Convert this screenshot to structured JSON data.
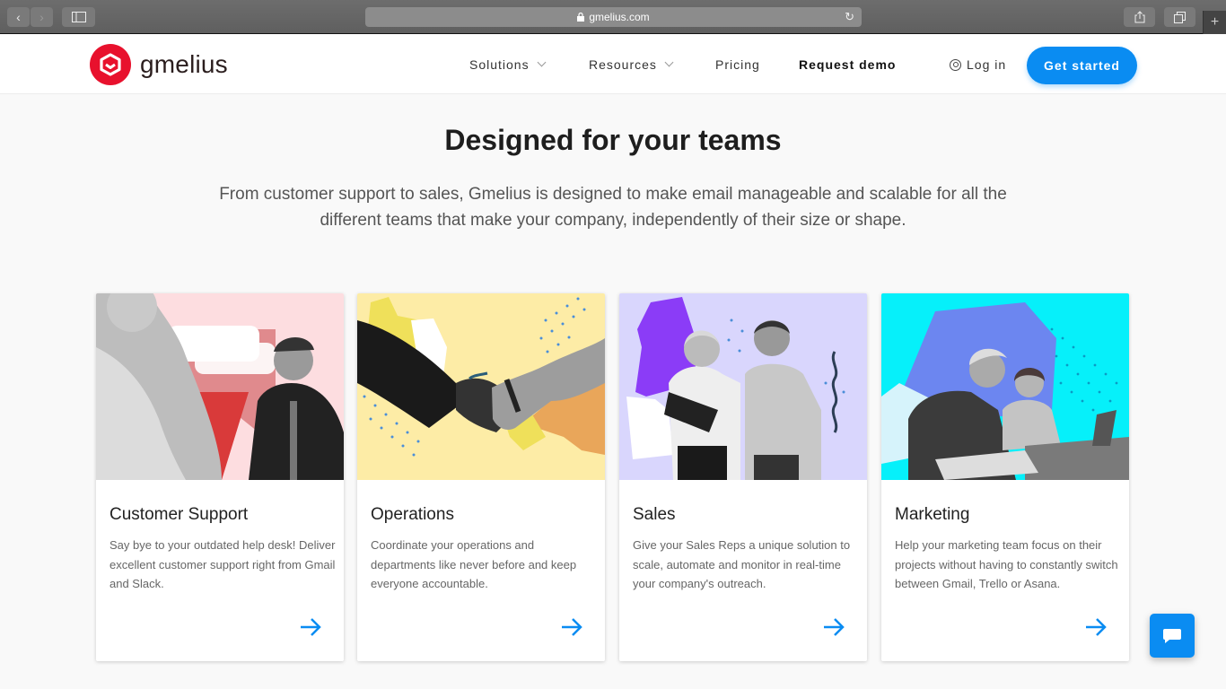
{
  "browser": {
    "url": "gmelius.com",
    "back_icon": "chevron-left-icon",
    "forward_icon": "chevron-right-icon",
    "sidebar_icon": "sidebar-icon",
    "share_icon": "share-icon",
    "tabs_icon": "tabs-icon",
    "new_tab_icon": "plus-icon"
  },
  "nav": {
    "brand": "gmelius",
    "items": [
      {
        "label": "Solutions",
        "has_dropdown": true
      },
      {
        "label": "Resources",
        "has_dropdown": true
      },
      {
        "label": "Pricing",
        "has_dropdown": false
      },
      {
        "label": "Request demo",
        "has_dropdown": false
      }
    ],
    "login": "Log in",
    "cta": "Get started"
  },
  "hero": {
    "title": "Designed for your teams",
    "subtitle": "From customer support to sales, Gmelius is designed to make email manageable and scalable for all the different teams that make your company, independently of their size or shape."
  },
  "cards": [
    {
      "title": "Customer Support",
      "text": "Say bye to your outdated help desk! Deliver excellent customer support right from Gmail and Slack.",
      "bg": "#fddde0",
      "accent": "#d93a3a"
    },
    {
      "title": "Operations",
      "text": "Coordinate your operations and departments like never before and keep everyone accountable.",
      "bg": "#fdeca6",
      "accent": "#efe05a"
    },
    {
      "title": "Sales",
      "text": "Give your Sales Reps a unique solution to scale, automate and monitor in real-time your company's outreach.",
      "bg": "#d9d6fd",
      "accent": "#8b3cf7"
    },
    {
      "title": "Marketing",
      "text": "Help your marketing team focus on their projects without having to constantly switch between Gmail, Trello or Asana.",
      "bg": "#06f0fa",
      "accent": "#6c86f0"
    }
  ],
  "colors": {
    "brand_red": "#e8112d",
    "primary_blue": "#0a8cf2"
  }
}
